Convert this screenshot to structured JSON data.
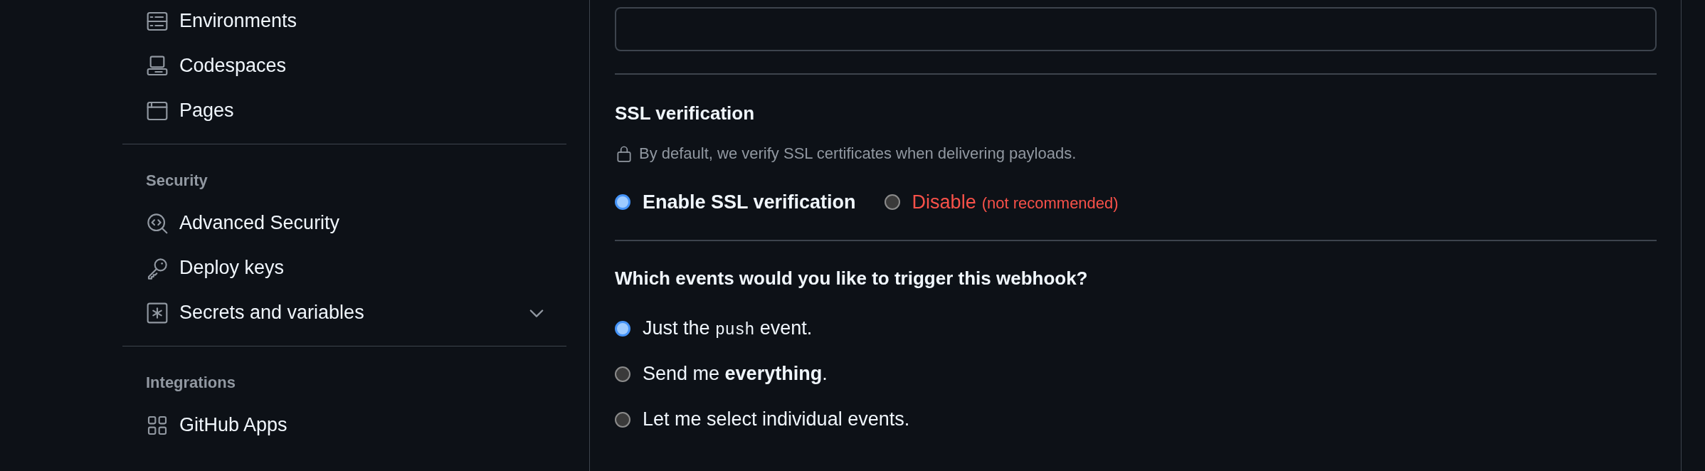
{
  "sidebar": {
    "groups": [
      {
        "items": [
          {
            "label": "Environments"
          },
          {
            "label": "Codespaces"
          },
          {
            "label": "Pages"
          }
        ]
      },
      {
        "heading": "Security",
        "items": [
          {
            "label": "Advanced Security"
          },
          {
            "label": "Deploy keys"
          },
          {
            "label": "Secrets and variables",
            "expanded": false
          }
        ]
      },
      {
        "heading": "Integrations",
        "items": [
          {
            "label": "GitHub Apps"
          }
        ]
      }
    ]
  },
  "ssl": {
    "title": "SSL verification",
    "description": "By default, we verify SSL certificates when delivering payloads.",
    "options": [
      {
        "kind": "normal",
        "label": "Enable SSL verification",
        "selected": true
      },
      {
        "kind": "danger",
        "label": "Disable",
        "note": "(not recommended)",
        "selected": false
      }
    ]
  },
  "events": {
    "question": "Which events would you like to trigger this webhook?",
    "options": [
      {
        "selected": true,
        "segments": [
          {
            "kind": "plain",
            "text": "Just the "
          },
          {
            "kind": "code",
            "text": "push"
          },
          {
            "kind": "plain",
            "text": " event."
          }
        ]
      },
      {
        "selected": false,
        "segments": [
          {
            "kind": "plain",
            "text": "Send me "
          },
          {
            "kind": "bold",
            "text": "everything"
          },
          {
            "kind": "plain",
            "text": "."
          }
        ]
      },
      {
        "selected": false,
        "segments": [
          {
            "kind": "plain",
            "text": "Let me select individual events."
          }
        ]
      }
    ]
  }
}
